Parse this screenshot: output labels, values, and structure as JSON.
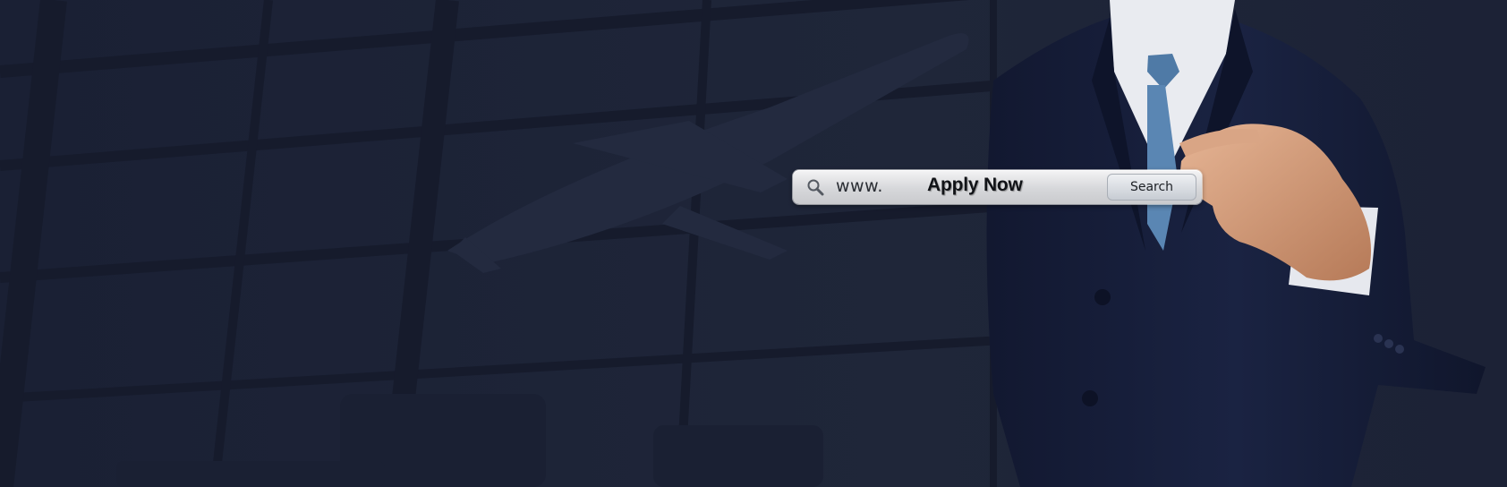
{
  "search": {
    "url_prefix": "www.",
    "query_text": "Apply Now",
    "button_label": "Search",
    "icon": "search-icon"
  },
  "colors": {
    "background": "#1d2438",
    "suit": "#151c34",
    "tie": "#4f7aa6",
    "bar": "#d6d7da"
  }
}
